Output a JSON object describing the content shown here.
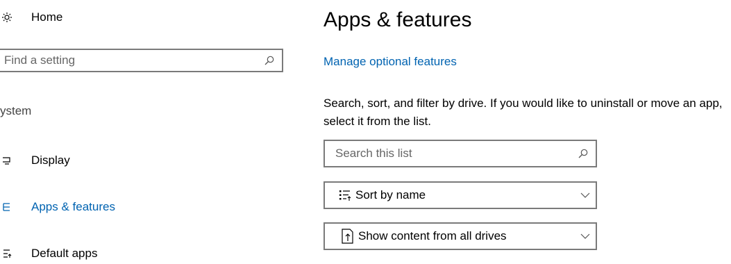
{
  "sidebar": {
    "home_label": "Home",
    "search_placeholder": "Find a setting",
    "section_label": "ystem",
    "items": [
      {
        "label": "Display",
        "icon": "display-icon"
      },
      {
        "label": "Apps & features",
        "icon": "apps-features-icon",
        "active": true
      },
      {
        "label": "Default apps",
        "icon": "default-apps-icon"
      }
    ]
  },
  "main": {
    "title": "Apps & features",
    "link": "Manage optional features",
    "description": "Search, sort, and filter by drive. If you would like to uninstall or move an app, select it from the list.",
    "search_placeholder": "Search this list",
    "sort_label": "Sort by name",
    "filter_label": "Show content from all drives"
  },
  "colors": {
    "accent": "#0063b1",
    "border": "#7a7a7a"
  }
}
